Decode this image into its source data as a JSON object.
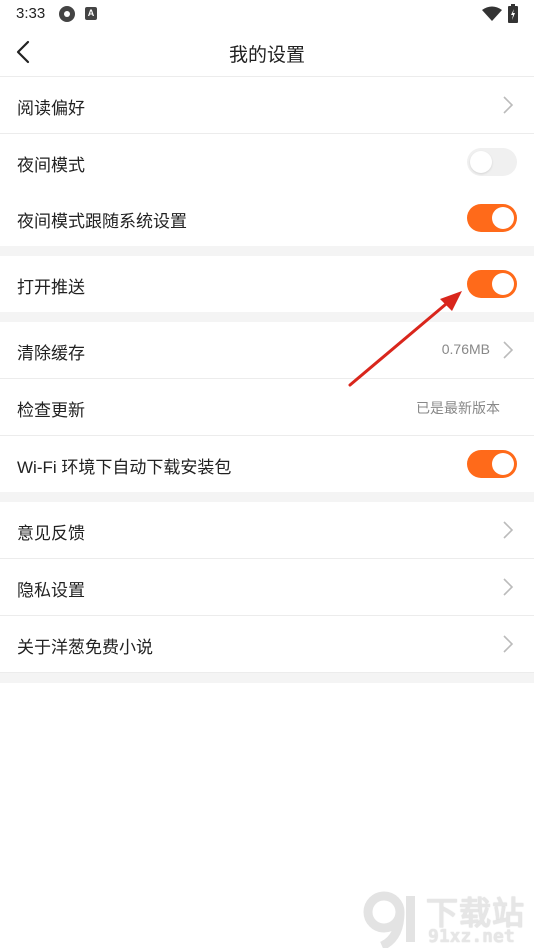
{
  "status_bar": {
    "time": "3:33"
  },
  "nav": {
    "title": "我的设置"
  },
  "groups": [
    {
      "rows": [
        {
          "label": "阅读偏好"
        },
        {
          "label": "夜间模式",
          "toggle": "off"
        },
        {
          "label": "夜间模式跟随系统设置",
          "toggle": "on"
        }
      ]
    },
    {
      "rows": [
        {
          "label": "打开推送",
          "toggle": "on"
        }
      ]
    },
    {
      "rows": [
        {
          "label": "清除缓存",
          "value": "0.76MB"
        },
        {
          "label": "检查更新",
          "value": "已是最新版本"
        },
        {
          "label": "Wi-Fi 环境下自动下载安装包",
          "toggle": "on"
        }
      ]
    },
    {
      "rows": [
        {
          "label": "意见反馈"
        },
        {
          "label": "隐私设置"
        },
        {
          "label": "关于洋葱免费小说"
        }
      ]
    }
  ],
  "colors": {
    "accent": "#ff6a1a",
    "annotation_arrow": "#d9261c",
    "divider": "#ececec",
    "group_gap": "#f4f4f4"
  },
  "watermark": {
    "text": "下载站",
    "url": "91xz.net"
  }
}
